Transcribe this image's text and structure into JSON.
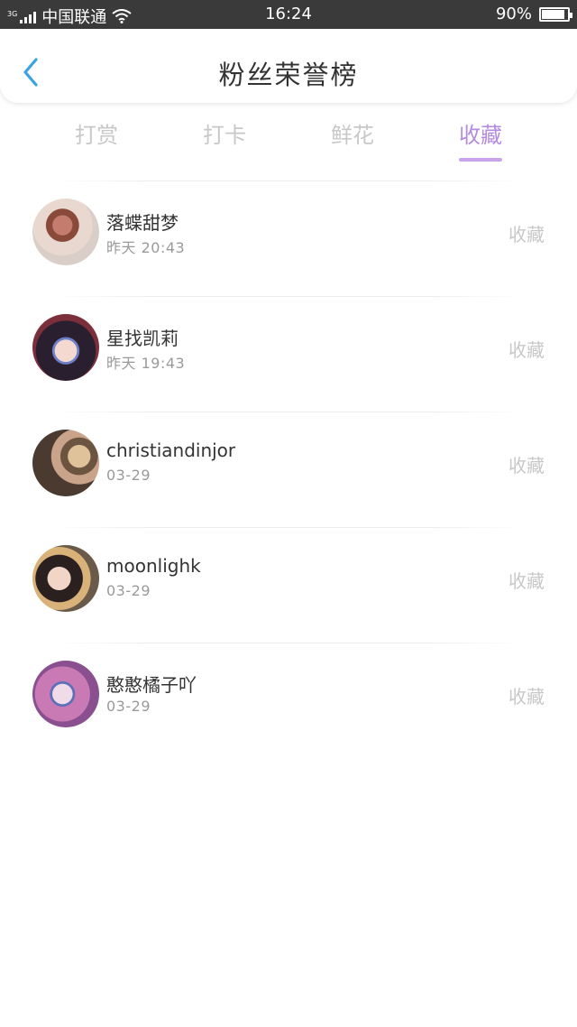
{
  "status": {
    "network": "3G",
    "carrier": "中国联通",
    "time": "16:24",
    "battery": "90%",
    "battery_level": 0.9
  },
  "header": {
    "title": "粉丝荣誉榜",
    "back_icon": "chevron-left-icon",
    "accent": "#3aa3e3"
  },
  "tabs": [
    {
      "label": "打赏"
    },
    {
      "label": "打卡"
    },
    {
      "label": "鲜花"
    },
    {
      "label": "收藏",
      "active": true
    }
  ],
  "tab_accent": "#b48be0",
  "fans": [
    {
      "name": "落蝶甜梦",
      "time": "昨天  20:43",
      "action": "收藏"
    },
    {
      "name": "星找凯莉",
      "time": "昨天  19:43",
      "action": "收藏"
    },
    {
      "name": "christiandinjor",
      "time": "03-29",
      "action": "收藏"
    },
    {
      "name": "moonlighk",
      "time": "03-29",
      "action": "收藏"
    },
    {
      "name": "憨憨橘子吖",
      "time": "03-29",
      "action": "收藏"
    }
  ]
}
